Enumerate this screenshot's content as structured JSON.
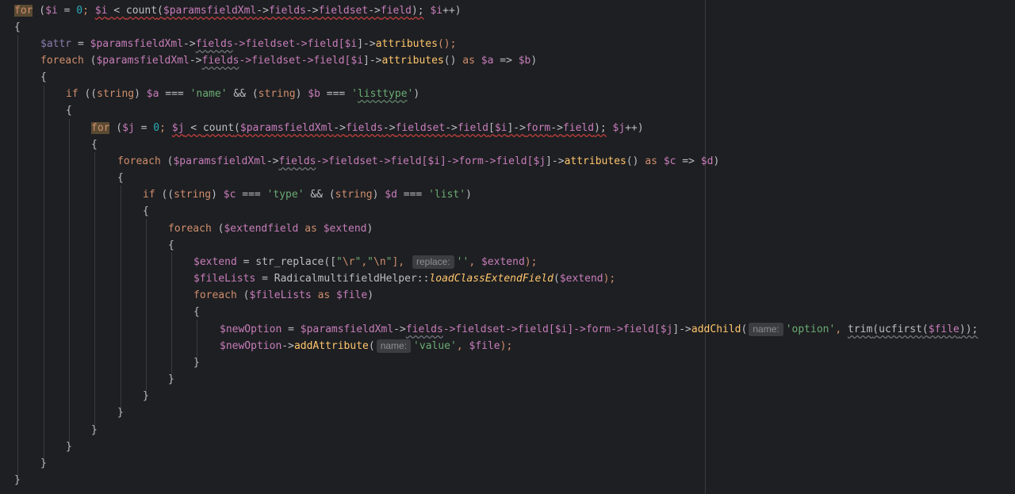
{
  "editor": {
    "language": "php",
    "hints": {
      "replace": "replace:",
      "name": "name:"
    }
  },
  "code": {
    "l01": {
      "for": "for",
      "open": " (",
      "i1": "$i",
      "eq0": " = ",
      "zero": "0",
      "sc1": "; ",
      "i2": "$i",
      "lt": " < ",
      "count": "count",
      "op": "(",
      "xml": "$paramsfieldXml",
      "p1": "->",
      "fields": "fields",
      "p2": "->",
      "fieldset": "fieldset",
      "p3": "->",
      "field": "field",
      "cl": ");",
      "sp": " ",
      "i3": "$i",
      "inc": "++)"
    },
    "l02": "{",
    "l03": {
      "attr": "$attr",
      "eq": " = ",
      "xml": "$paramsfieldXml",
      "p1": "->",
      "fields": "fields",
      "rest": "->fieldset->field[",
      "i": "$i",
      "rest2": "]->",
      "fn": "attributes",
      "end": "();"
    },
    "l04": {
      "kw": "foreach",
      "open": " (",
      "xml": "$paramsfieldXml",
      "p1": "->",
      "fields": "fields",
      "rest": "->fieldset->field[",
      "i": "$i",
      "rest2": "]->",
      "fn": "attributes",
      "paren": "() ",
      "as": "as",
      "sp": " ",
      "a": "$a",
      "arrow": " => ",
      "b": "$b",
      "end": ")"
    },
    "l05": "{",
    "l06": {
      "kw": "if",
      "open": " ((",
      "t1": "string",
      "c1": ") ",
      "a": "$a",
      "eq": " === ",
      "s1": "'name'",
      "and": " && (",
      "t2": "string",
      "c2": ") ",
      "b": "$b",
      "eq2": " === ",
      "q1": "'",
      "s2": "listtype",
      "q2": "'",
      "end": ")"
    },
    "l07": "{",
    "l08": {
      "for": "for",
      "open": " (",
      "j1": "$j",
      "eq0": " = ",
      "zero": "0",
      "sc1": "; ",
      "j2": "$j",
      "lt": " < ",
      "count": "count",
      "op": "(",
      "xml": "$paramsfieldXml",
      "p1": "->",
      "fields": "fields",
      "p2": "->",
      "fieldset": "fieldset",
      "p3": "->",
      "field": "field",
      "br": "[",
      "i": "$i",
      "br2": "]->",
      "form": "form",
      "p4": "->",
      "field2": "field",
      "cl": ");",
      "sp": " ",
      "j3": "$j",
      "inc": "++)"
    },
    "l09": "{",
    "l10": {
      "kw": "foreach",
      "open": " (",
      "xml": "$paramsfieldXml",
      "p1": "->",
      "fields": "fields",
      "rest": "->fieldset->field[",
      "i": "$i",
      "rest2": "]->form->field[",
      "j": "$j",
      "rest3": "]->",
      "fn": "attributes",
      "paren": "() ",
      "as": "as",
      "sp": " ",
      "c": "$c",
      "arrow": " => ",
      "d": "$d",
      "end": ")"
    },
    "l11": "{",
    "l12": {
      "kw": "if",
      "open": " ((",
      "t1": "string",
      "c1": ") ",
      "c": "$c",
      "eq": " === ",
      "s1": "'type'",
      "and": " && (",
      "t2": "string",
      "c2": ") ",
      "d": "$d",
      "eq2": " === ",
      "s2": "'list'",
      "end": ")"
    },
    "l13": "{",
    "l14": {
      "kw": "foreach",
      "open": " (",
      "ef": "$extendfield",
      "sp": " ",
      "as": "as",
      "sp2": " ",
      "ex": "$extend",
      "end": ")"
    },
    "l15": "{",
    "l16": {
      "ex": "$extend",
      "eq": " = ",
      "fn": "str_replace",
      "op": "([",
      "q1": "\"",
      "e1": "\\r",
      "q2": "\"",
      "cm": ",",
      "q3": "\"",
      "e2": "\\n",
      "q4": "\"",
      "cb": "], ",
      "s": "''",
      "cm2": ", ",
      "ex2": "$extend",
      "end": ");"
    },
    "l17": {
      "fl": "$fileLists",
      "eq": " = ",
      "cls": "RadicalmultifieldHelper",
      "dc": "::",
      "fn": "loadClassExtendField",
      "op": "(",
      "ex": "$extend",
      "end": ");"
    },
    "l18": {
      "kw": "foreach",
      "open": " (",
      "fl": "$fileLists",
      "sp": " ",
      "as": "as",
      "sp2": " ",
      "f": "$file",
      "end": ")"
    },
    "l19": "{",
    "l20": {
      "no": "$newOption",
      "eq": " = ",
      "xml": "$paramsfieldXml",
      "p1": "->",
      "fields": "fields",
      "rest": "->fieldset->field[",
      "i": "$i",
      "rest2": "]->form->field[",
      "j": "$j",
      "rest3": "]->",
      "fn": "addChild",
      "op": "(",
      "s": "'option'",
      "cm": ", ",
      "trim": "trim",
      "o1": "(",
      "uc": "ucfirst",
      "o2": "(",
      "f": "$file",
      "end": "));"
    },
    "l21": {
      "no": "$newOption",
      "p": "->",
      "fn": "addAttribute",
      "op": "(",
      "s": "'value'",
      "cm": ", ",
      "f": "$file",
      "end": ");"
    },
    "l22": "}",
    "l23": "}",
    "l24": "}",
    "l25": "}",
    "l26": "}",
    "l27": "}",
    "l28": "}",
    "l29": "}"
  }
}
